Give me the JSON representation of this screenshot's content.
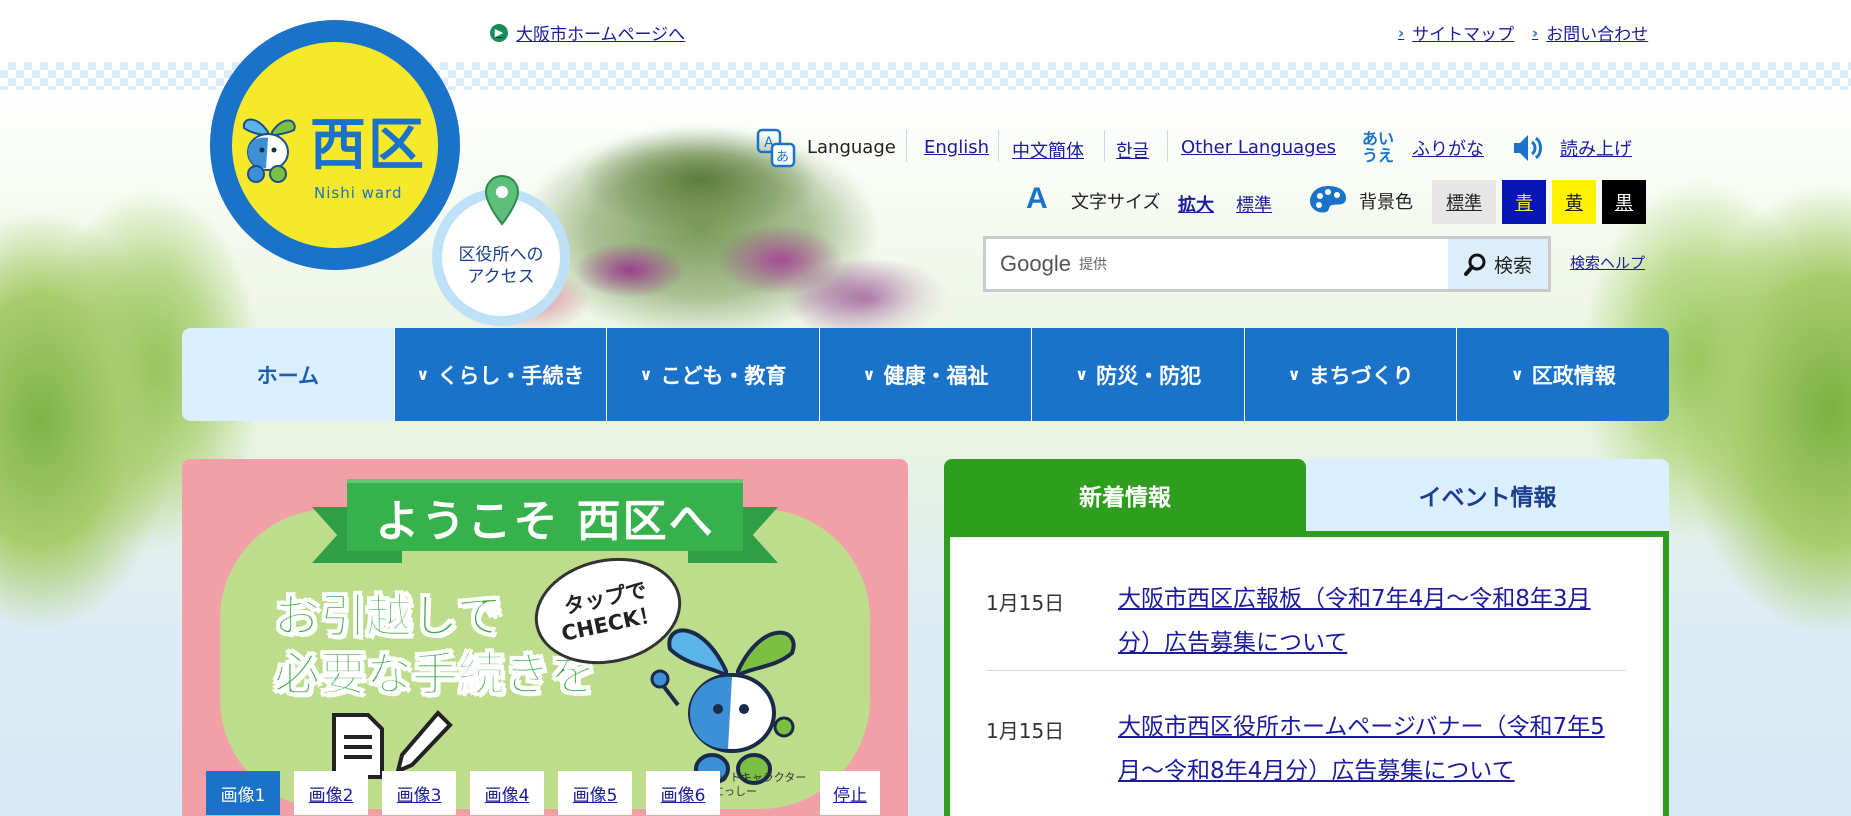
{
  "top_links": {
    "city_home": "大阪市ホームページへ",
    "sitemap": "サイトマップ",
    "contact": "お問い合わせ"
  },
  "logo": {
    "title": "西区",
    "subtitle": "Nishi ward"
  },
  "access": {
    "label_line1": "区役所への",
    "label_line2": "アクセス"
  },
  "language": {
    "label": "Language",
    "options": [
      "English",
      "中文簡体",
      "한글",
      "Other Languages"
    ]
  },
  "furigana": {
    "icon_text_top": "あい",
    "icon_text_bottom": "うえ",
    "label": "ふりがな"
  },
  "read_aloud": "読み上げ",
  "font_size": {
    "label": "文字サイズ",
    "enlarge": "拡大",
    "standard": "標準"
  },
  "bg_color": {
    "label": "背景色",
    "options": [
      {
        "label": "標準",
        "bg": "#e6e6e6",
        "fg": "#222222"
      },
      {
        "label": "青",
        "bg": "#0a16b4",
        "fg": "#f6e92c"
      },
      {
        "label": "黄",
        "bg": "#fff200",
        "fg": "#222222"
      },
      {
        "label": "黒",
        "bg": "#000000",
        "fg": "#ffffff"
      }
    ]
  },
  "search": {
    "provider": "Google",
    "provided_by": "提供",
    "button": "検索",
    "help": "検索ヘルプ"
  },
  "nav": {
    "items": [
      "ホーム",
      "くらし・手続き",
      "こども・教育",
      "健康・福祉",
      "防災・防犯",
      "まちづくり",
      "区政情報"
    ]
  },
  "slide": {
    "ribbon": "ようこそ 西区へ",
    "heading_line1": "お引越しで",
    "heading_line2": "必要な手続きを",
    "bubble_line1": "タップで",
    "bubble_line2": "CHECK！",
    "caption_line1": "西区マスコットキャラクター",
    "caption_line2": "にっしー",
    "buttons": [
      "画像1",
      "画像2",
      "画像3",
      "画像4",
      "画像5",
      "画像6"
    ],
    "stop": "停止"
  },
  "news": {
    "tab_new": "新着情報",
    "tab_event": "イベント情報",
    "items": [
      {
        "date": "1月15日",
        "title": "大阪市西区広報板（令和7年4月～令和8年3月分）広告募集について"
      },
      {
        "date": "1月15日",
        "title": "大阪市西区役所ホームページバナー（令和7年5月～令和8年4月分）広告募集について"
      }
    ]
  },
  "colors": {
    "brand_blue": "#1a73c9",
    "logo_yellow": "#f6e92c",
    "news_green": "#2f9e1f",
    "slide_pink": "#f1a0a8"
  }
}
